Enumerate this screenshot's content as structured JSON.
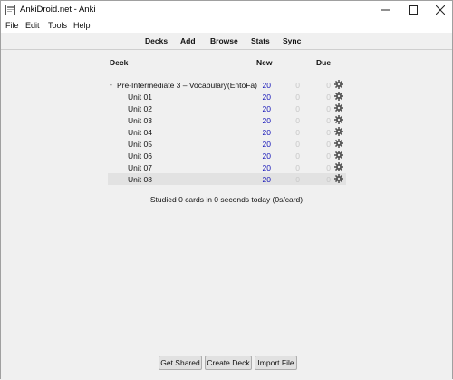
{
  "window": {
    "title": "AnkiDroid.net - Anki"
  },
  "menu": {
    "file": "File",
    "edit": "Edit",
    "tools": "Tools",
    "help": "Help"
  },
  "toolbar": {
    "decks": "Decks",
    "add": "Add",
    "browse": "Browse",
    "stats": "Stats",
    "sync": "Sync"
  },
  "table": {
    "col_deck": "Deck",
    "col_new": "New",
    "col_due": "Due"
  },
  "decks": [
    {
      "name": "Pre-Intermediate 3 – Vocabulary(EntoFa)",
      "new": "20",
      "learn": "0",
      "due": "0",
      "collapse": "-"
    },
    {
      "name": "Unit 01",
      "new": "20",
      "learn": "0",
      "due": "0"
    },
    {
      "name": "Unit 02",
      "new": "20",
      "learn": "0",
      "due": "0"
    },
    {
      "name": "Unit 03",
      "new": "20",
      "learn": "0",
      "due": "0"
    },
    {
      "name": "Unit 04",
      "new": "20",
      "learn": "0",
      "due": "0"
    },
    {
      "name": "Unit 05",
      "new": "20",
      "learn": "0",
      "due": "0"
    },
    {
      "name": "Unit 06",
      "new": "20",
      "learn": "0",
      "due": "0"
    },
    {
      "name": "Unit 07",
      "new": "20",
      "learn": "0",
      "due": "0"
    },
    {
      "name": "Unit 08",
      "new": "20",
      "learn": "0",
      "due": "0"
    }
  ],
  "studied": "Studied 0 cards in 0 seconds today (0s/card)",
  "buttons": {
    "get_shared": "Get Shared",
    "create_deck": "Create Deck",
    "import_file": "Import File"
  },
  "colors": {
    "new": "#1515b8",
    "zero": "#c8c8c8",
    "selected_row": "#e2e2e2"
  }
}
